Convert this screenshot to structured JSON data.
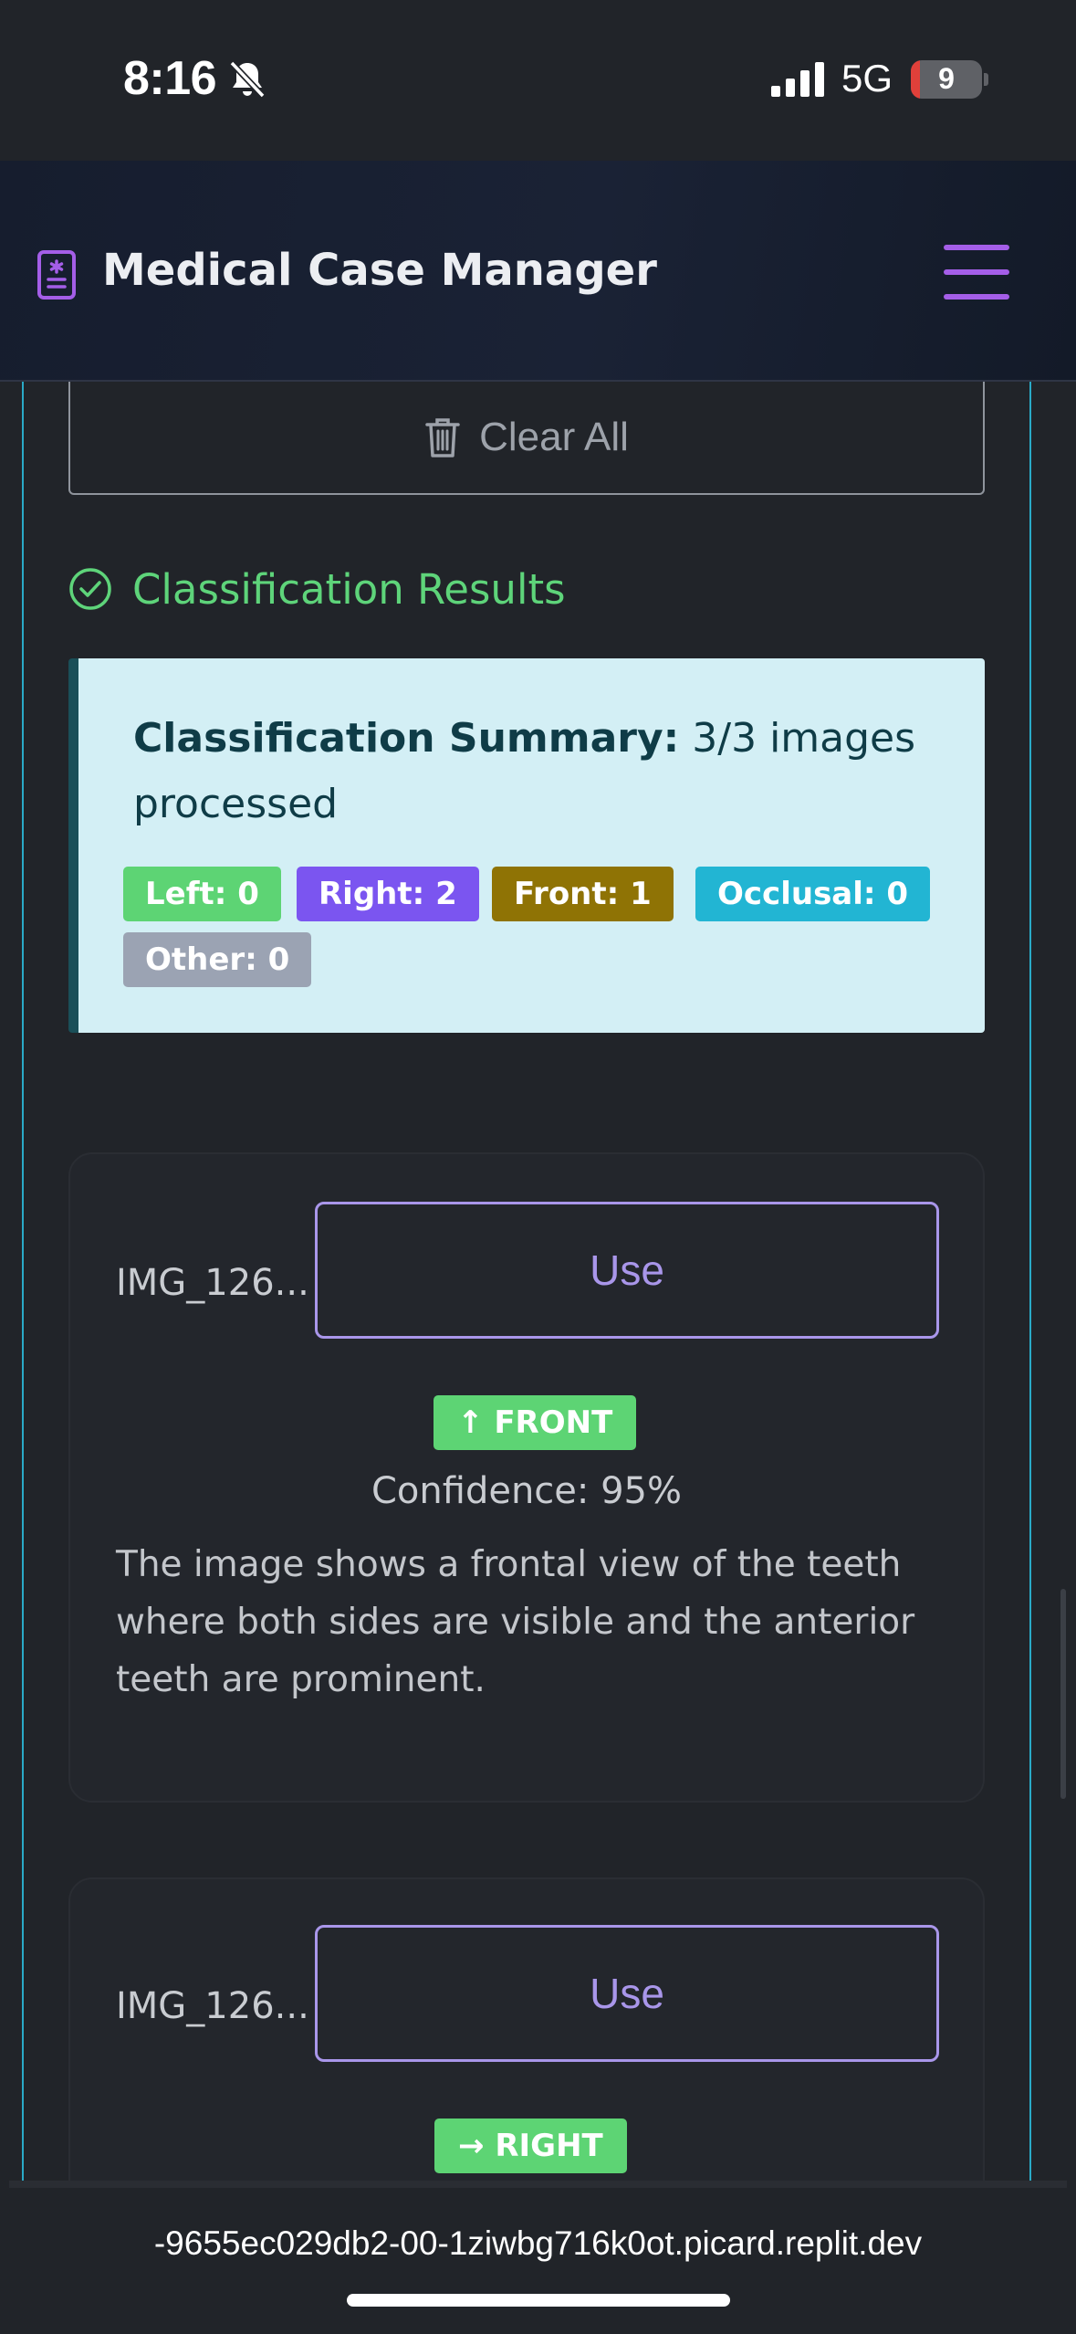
{
  "status_bar": {
    "time": "8:16",
    "network": "5G",
    "battery": "9"
  },
  "header": {
    "title": "Medical Case Manager"
  },
  "actions": {
    "clear_all": "Clear All"
  },
  "results": {
    "heading": "Classification Results",
    "summary_label": "Classification Summary:",
    "summary_value": " 3/3 images processed",
    "counts": [
      {
        "label": "Left: 0",
        "color": "#5dd474"
      },
      {
        "label": "Right: 2",
        "color": "#7b55f0"
      },
      {
        "label": "Front: 1",
        "color": "#8f7305"
      },
      {
        "label": "Occlusal: 0",
        "color": "#22b5d3"
      },
      {
        "label": "Other: 0",
        "color": "#9ba3b3"
      }
    ]
  },
  "images": [
    {
      "name": "IMG_126...",
      "use_label": "Use",
      "classification": "↑ FRONT",
      "confidence": "Confidence: 95%",
      "reason": "The image shows a frontal view of the teeth where both sides are visible and the anterior teeth are prominent."
    },
    {
      "name": "IMG_126...",
      "use_label": "Use",
      "classification": "→ RIGHT"
    }
  ],
  "browser": {
    "url": "-9655ec029db2-00-1ziwbg716k0ot.picard.replit.dev"
  }
}
